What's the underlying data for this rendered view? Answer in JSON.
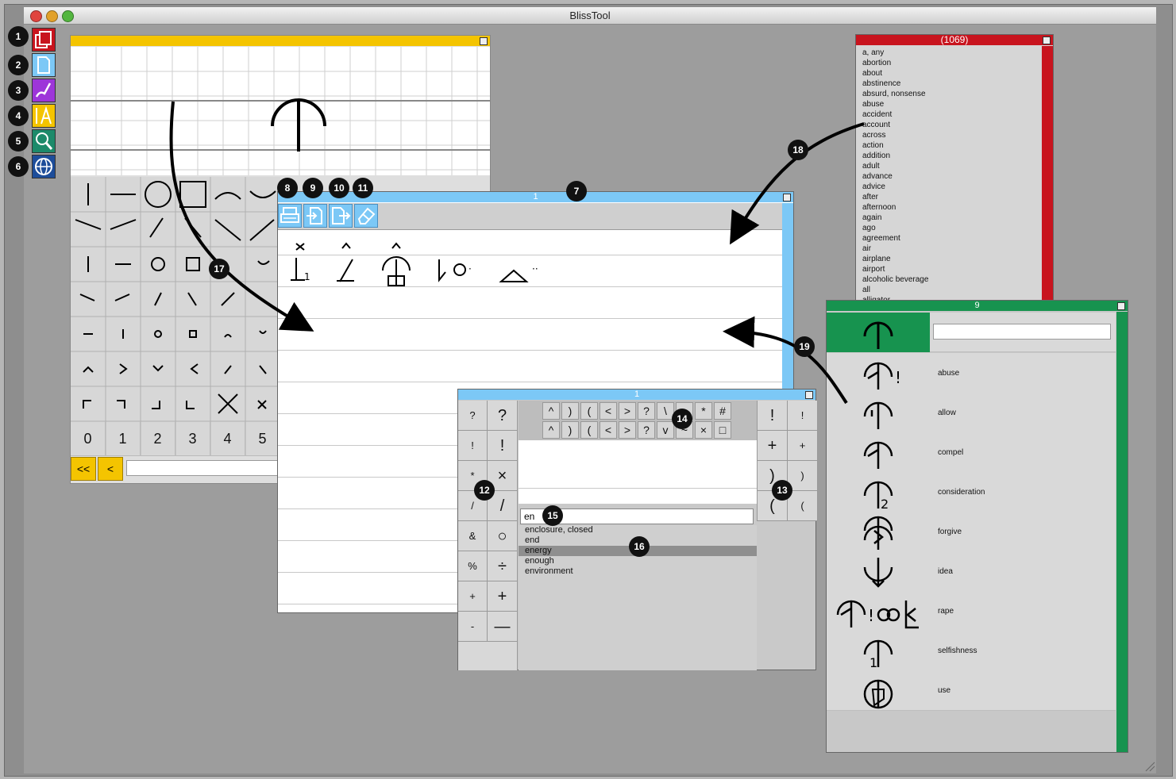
{
  "app": {
    "title": "BlissTool"
  },
  "colors": {
    "yellow": "#f4c400",
    "blue": "#7cc8f6",
    "red": "#c8141e",
    "green": "#17934f",
    "purple": "#9d35d9",
    "teal": "#1c8a6a",
    "navy": "#1d4d9a"
  },
  "toolbar": {
    "icons": [
      "documents-icon",
      "new-page-icon",
      "edit-pen-icon",
      "ruler-text-icon",
      "search-icon",
      "globe-icon"
    ]
  },
  "callouts": [
    "1",
    "2",
    "3",
    "4",
    "5",
    "6",
    "7",
    "8",
    "9",
    "10",
    "11",
    "12",
    "13",
    "14",
    "15",
    "16",
    "17",
    "18",
    "19"
  ],
  "grid_panel": {
    "nav_first": "<<",
    "nav_prev": "<",
    "digits": [
      "0",
      "1",
      "2",
      "3",
      "4",
      "5"
    ]
  },
  "composer": {
    "title": "1",
    "tool_icons": [
      "print-icon",
      "import-icon",
      "export-icon",
      "eraser-icon"
    ]
  },
  "keyboard": {
    "title": "1",
    "left_keys": [
      [
        "?",
        "?"
      ],
      [
        "!",
        "!"
      ],
      [
        "*",
        "×"
      ],
      [
        "/",
        "/"
      ],
      [
        "&",
        "○"
      ],
      [
        "%",
        "÷"
      ],
      [
        "+",
        "+"
      ],
      [
        "-",
        "—"
      ]
    ],
    "top_keys_row1": [
      "^",
      ")",
      "(",
      "<",
      ">",
      "?",
      "\\",
      "~",
      "*",
      "#"
    ],
    "top_keys_row2": [
      "^",
      ")",
      "(",
      "<",
      ">",
      "?",
      "v",
      "~",
      "×",
      "□"
    ],
    "right_keys": [
      [
        "!",
        "!"
      ],
      [
        "+",
        "+"
      ],
      [
        ")",
        ")"
      ],
      [
        "(",
        "("
      ]
    ],
    "search_value": "en",
    "results": [
      "enclosure, closed",
      "end",
      "energy",
      "enough",
      "environment"
    ],
    "selected_index": 2
  },
  "word_list": {
    "title": "(1069)",
    "items": [
      "a, any",
      "abortion",
      "about",
      "abstinence",
      "absurd, nonsense",
      "abuse",
      "accident",
      "account",
      "across",
      "action",
      "addition",
      "adult",
      "advance",
      "advice",
      "after",
      "afternoon",
      "again",
      "ago",
      "agreement",
      "air",
      "airplane",
      "airport",
      "alcoholic beverage",
      "all",
      "alligator"
    ]
  },
  "symbol_list": {
    "title": "9",
    "search_value": "",
    "items": [
      "abuse",
      "allow",
      "compel",
      "consideration",
      "forgive",
      "idea",
      "rape",
      "selfishness",
      "use"
    ]
  }
}
